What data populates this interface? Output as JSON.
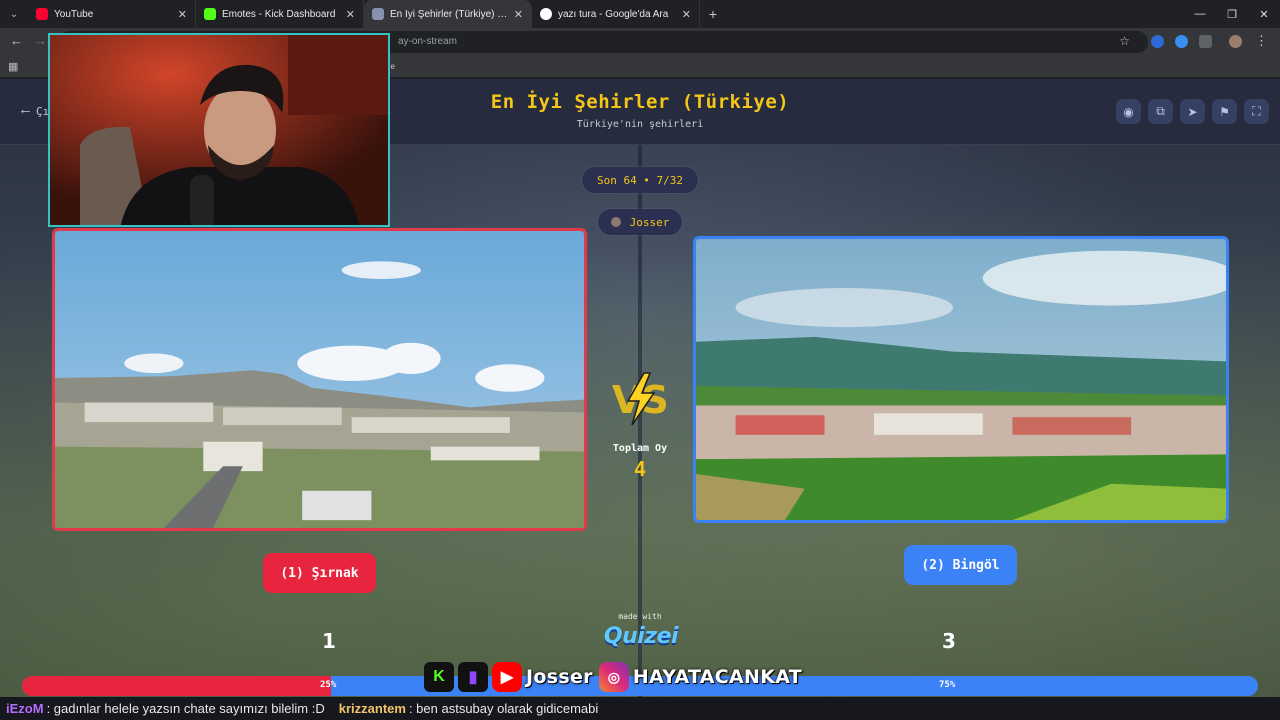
{
  "browser": {
    "tabs": [
      {
        "title": "YouTube",
        "color": "#ff0033",
        "active": false
      },
      {
        "title": "Emotes - Kick Dashboard",
        "color": "#53fc18",
        "active": false
      },
      {
        "title": "En İyi Şehirler (Türkiye) - Quizei",
        "color": "#8892b0",
        "active": true
      },
      {
        "title": "yazı tura - Google'da Ara",
        "color": "#ffffff",
        "active": false
      }
    ],
    "url_fragment": "ay-on-stream",
    "bookmark_fragment": "ne"
  },
  "quiz": {
    "back_label": "Çı",
    "title": "En İyi Şehirler (Türkiye)",
    "subtitle": "Türkiye'nin şehirleri",
    "round": "Son 64 • 7/32",
    "player": "Josser",
    "vs_label": "VS",
    "total_label": "Toplam Oy",
    "total_value": "4",
    "option1": {
      "label": "(1) Şırnak",
      "votes": "1",
      "percent": "25%",
      "color": "#e8253f"
    },
    "option2": {
      "label": "(2) Bingöl",
      "votes": "3",
      "percent": "75%",
      "color": "#3b82f6"
    },
    "share_fraction": 0.25,
    "made_with": "made with",
    "brand": "Quizei"
  },
  "overlay": {
    "socials": [
      {
        "icon": "kick-icon",
        "glyph": "K",
        "color": "#53fc18"
      },
      {
        "icon": "twitch-icon",
        "glyph": "▮",
        "color": "#9146ff"
      },
      {
        "icon": "youtube-icon",
        "glyph": "▶",
        "color": "#ff0000"
      }
    ],
    "name1": "Josser",
    "name2": "HAYATACANKAT"
  },
  "chat": [
    {
      "user": "iEzoM",
      "user_color": "#b36cff",
      "message": ": gadınlar helele yazsın chate sayımızı bilelim :D"
    },
    {
      "user": "krizzantem",
      "user_color": "#f0c46a",
      "message": ": ben astsubay olarak gidicemabi"
    }
  ]
}
